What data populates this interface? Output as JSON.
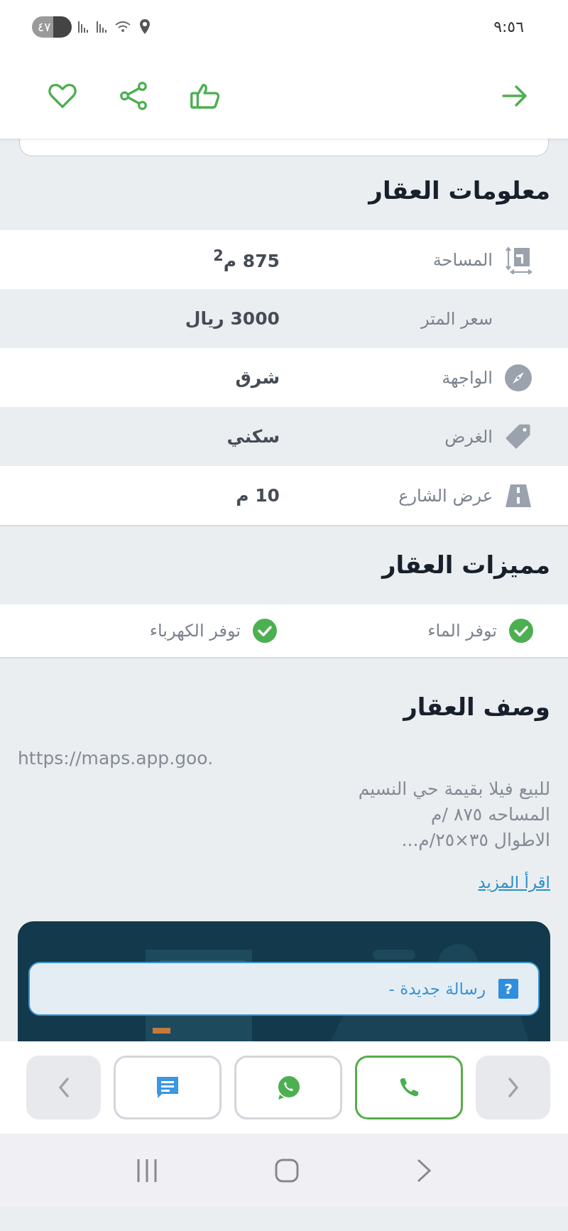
{
  "status_bar": {
    "time": "٩:٥٦",
    "battery": "٤٧"
  },
  "toolbar": {
    "actions": [
      {
        "kind": "favorite"
      },
      {
        "kind": "share"
      },
      {
        "kind": "like"
      }
    ],
    "back": {
      "kind": "forward-arrow"
    }
  },
  "property_info": {
    "title": "معلومات العقار",
    "rows": [
      {
        "kind": "area",
        "label": "المساحة",
        "value": "875 م$^{2}$"
      },
      {
        "kind": "plain",
        "label": "سعر المتر",
        "value": "3000 ريال"
      },
      {
        "kind": "compass",
        "label": "الواجهة",
        "value": "شرق"
      },
      {
        "kind": "tag",
        "label": "الغرض",
        "value": "سكني"
      },
      {
        "kind": "road",
        "label": "عرض الشارع",
        "value": "10 م"
      }
    ]
  },
  "features": {
    "title": "مميزات العقار",
    "items": [
      {
        "label": "توفر الماء",
        "checked": true
      },
      {
        "label": "توفر الكهرباء",
        "checked": true
      }
    ]
  },
  "description": {
    "title": "وصف العقار",
    "url": "https://maps.app.goo.",
    "lines": [
      "للبيع فيلا بقيمة حي النسيم",
      "المساحه ٨٧٥ /م",
      "الاطوال ٣٥×٢٥/م..."
    ],
    "read_more": "اقرأ المزيد"
  },
  "toast": {
    "text": "رسالة جديدة -",
    "icon": "?"
  },
  "contact_bar": {
    "buttons": [
      {
        "kind": "next"
      },
      {
        "kind": "phone",
        "highlighted": true
      },
      {
        "kind": "whatsapp",
        "highlighted": false
      },
      {
        "kind": "chat",
        "highlighted": false
      },
      {
        "kind": "prev"
      }
    ]
  }
}
